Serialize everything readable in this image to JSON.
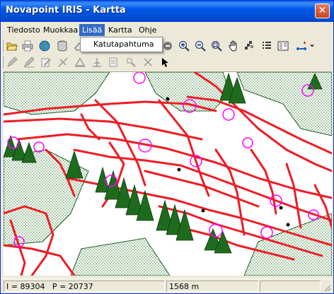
{
  "window": {
    "title": "Novapoint IRIS - Kartta",
    "close_symbol": "✕"
  },
  "menu": {
    "items": [
      "Tiedosto",
      "Muokkaa",
      "Lisää",
      "Kartta",
      "Ohje"
    ],
    "open_menu": "Lisää",
    "dropdown_items": [
      "Katutapahtuma"
    ]
  },
  "toolbar1": {
    "icons": [
      "open-folder-icon",
      "print-icon",
      "globe-icon",
      "database-icon",
      "eraser-icon",
      "layers-icon",
      "zoom-in-icon",
      "zoom-out-icon",
      "zoom-extent-icon",
      "pan-hand-icon",
      "grid-icon",
      "list-icon",
      "map-legend-icon",
      "route-icon"
    ]
  },
  "toolbar2": {
    "icons": [
      "pencil-icon",
      "draw-line-icon",
      "edit-icon",
      "cross-line-icon",
      "triangle-icon",
      "split-icon",
      "document-edit-icon",
      "move-node-icon",
      "delete-node-icon",
      "select-arrow-icon"
    ]
  },
  "map": {
    "colors": {
      "roads": "#ee1c24",
      "trees": "#1e6b1e",
      "symbols": "#ff00ff",
      "area_hatch": "#2d7a2d",
      "background": "#ffffff"
    }
  },
  "status": {
    "coordinates": "I = 89304   P = 20737",
    "scale": "1568 m"
  }
}
